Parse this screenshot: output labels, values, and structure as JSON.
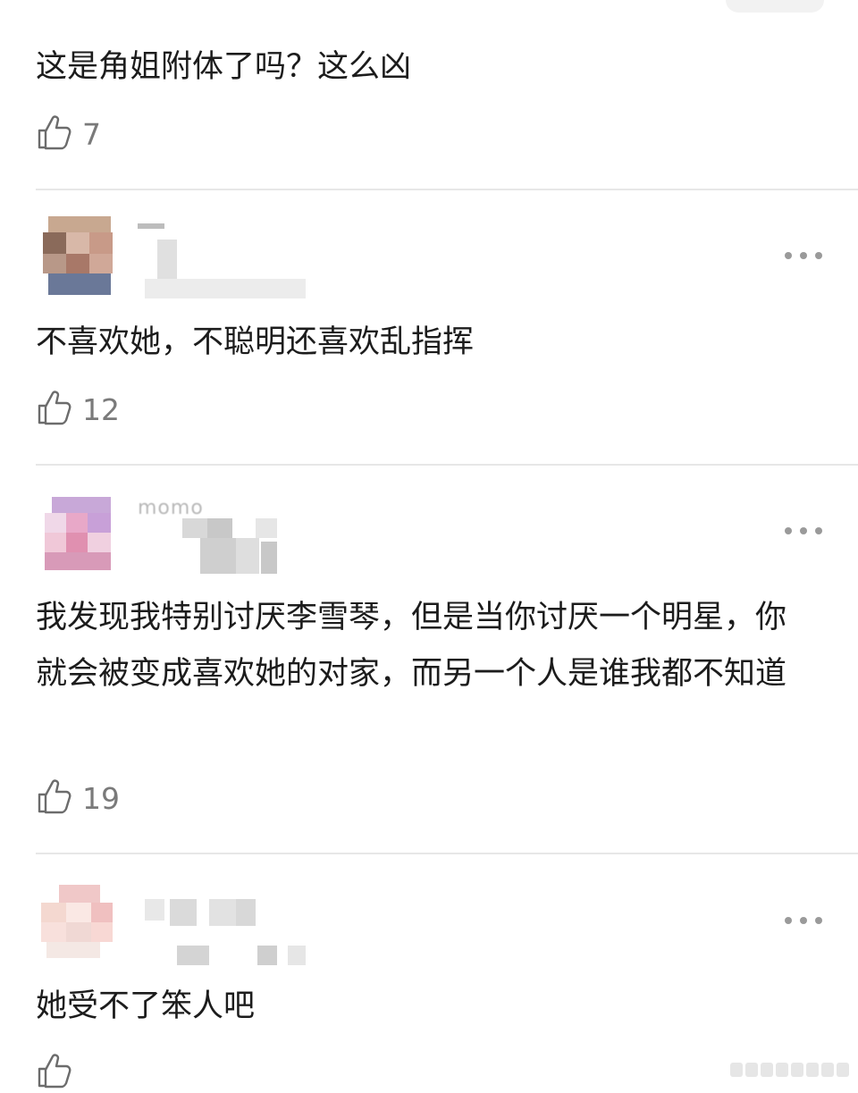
{
  "comments": [
    {
      "text": "这是角姐附体了吗？这么凶",
      "likes": "7"
    },
    {
      "name": "·····",
      "text": "不喜欢她，不聪明还喜欢乱指挥",
      "likes": "12"
    },
    {
      "name": "momo",
      "text": "我发现我特别讨厌李雪琴，但是当你讨厌一个明星，你就会被变成喜欢她的对家，而另一个人是谁我都不知道",
      "likes": "19"
    },
    {
      "text": "她受不了笨人吧",
      "likes": ""
    }
  ],
  "icons": {
    "like": "thumbs-up-icon",
    "more": "more-dots-icon"
  },
  "colors": {
    "text": "#1c1c1c",
    "count": "#7a7a7a",
    "divider": "#e7e7e7",
    "dots": "#9a9a9a"
  }
}
